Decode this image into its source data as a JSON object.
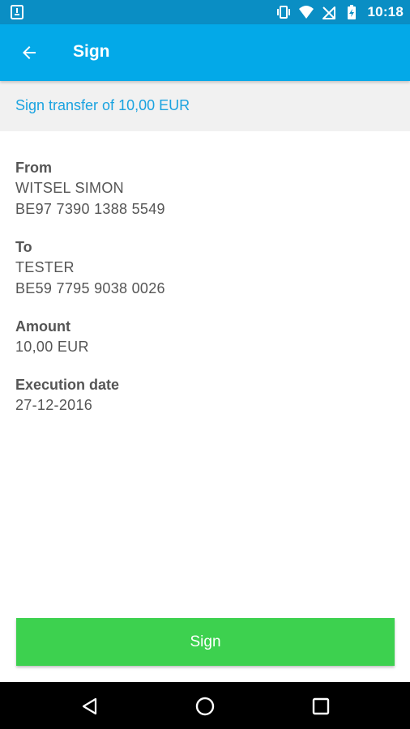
{
  "status_bar": {
    "time": "10:18",
    "icons": [
      "sim-card-icon",
      "vibrate-icon",
      "wifi-icon",
      "no-signal-icon",
      "battery-charging-icon"
    ]
  },
  "app_bar": {
    "title": "Sign",
    "back_icon": "arrow-left-icon"
  },
  "subheader": {
    "text": "Sign transfer of 10,00 EUR"
  },
  "details": {
    "from": {
      "label": "From",
      "name": "WITSEL SIMON",
      "iban": "BE97 7390 1388 5549"
    },
    "to": {
      "label": "To",
      "name": "TESTER",
      "iban": "BE59 7795 9038 0026"
    },
    "amount": {
      "label": "Amount",
      "value": "10,00 EUR"
    },
    "execution_date": {
      "label": "Execution date",
      "value": "27-12-2016"
    }
  },
  "actions": {
    "sign_label": "Sign"
  },
  "nav_bar": {
    "icons": [
      "back-triangle-icon",
      "home-circle-icon",
      "recents-square-icon"
    ]
  },
  "colors": {
    "status_bar": "#0a8ec4",
    "app_bar": "#03a9e8",
    "accent_text": "#1aa3e0",
    "sign_button": "#3dd14f",
    "subheader_bg": "#f1f1f1"
  }
}
